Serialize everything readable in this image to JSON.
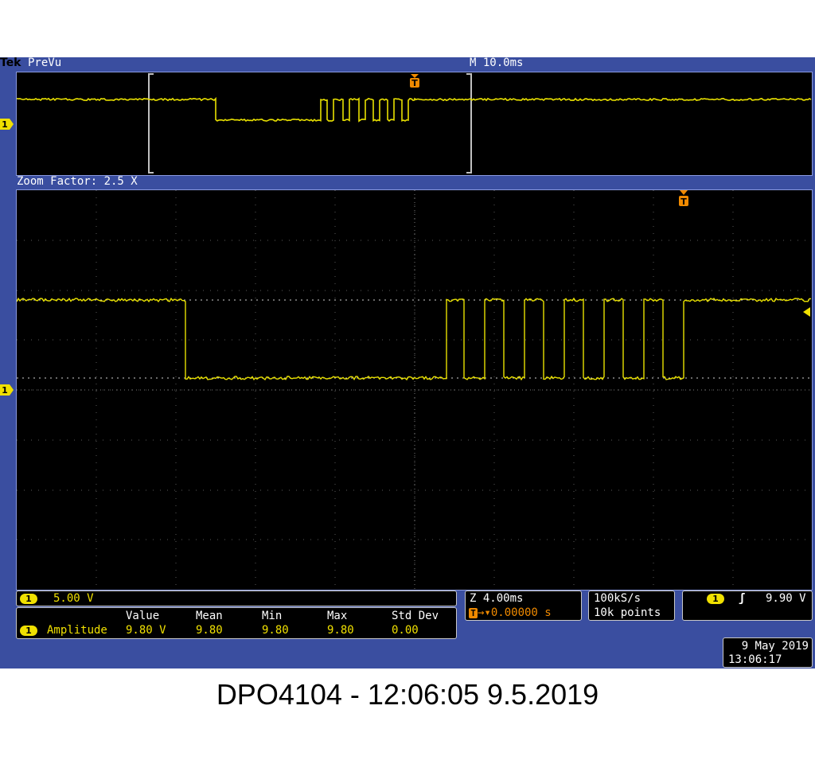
{
  "header": {
    "brand": "Tek",
    "mode": "PreVu",
    "main_timebase": "M 10.0ms"
  },
  "zoom": {
    "label": "Zoom Factor: 2.5 X"
  },
  "markers": {
    "trigger_glyph": "T",
    "channel_glyph": "1"
  },
  "vertical": {
    "channel": "1",
    "scale": "5.00 V"
  },
  "measurement": {
    "headers": [
      "Value",
      "Mean",
      "Min",
      "Max",
      "Std Dev"
    ],
    "channel": "1",
    "name": "Amplitude",
    "value": "9.80 V",
    "mean": "9.80",
    "min": "9.80",
    "max": "9.80",
    "std_dev": "0.00"
  },
  "horizontal": {
    "zoom_scale": "Z 4.00ms",
    "trigger_position": "0.00000 s"
  },
  "acquisition": {
    "sample_rate": "100kS/s",
    "record_length": "10k points"
  },
  "trigger": {
    "channel": "1",
    "slope_glyph": "ʃ",
    "level": "9.90 V"
  },
  "datetime": {
    "date": "9 May 2019",
    "time": "13:06:17"
  },
  "caption": "DPO4104 - 12:06:05   9.5.2019",
  "colors": {
    "frame": "#3a4ea0",
    "trace": "#e8e000",
    "trigger_marker": "#f08a00",
    "screen": "#000000"
  }
}
